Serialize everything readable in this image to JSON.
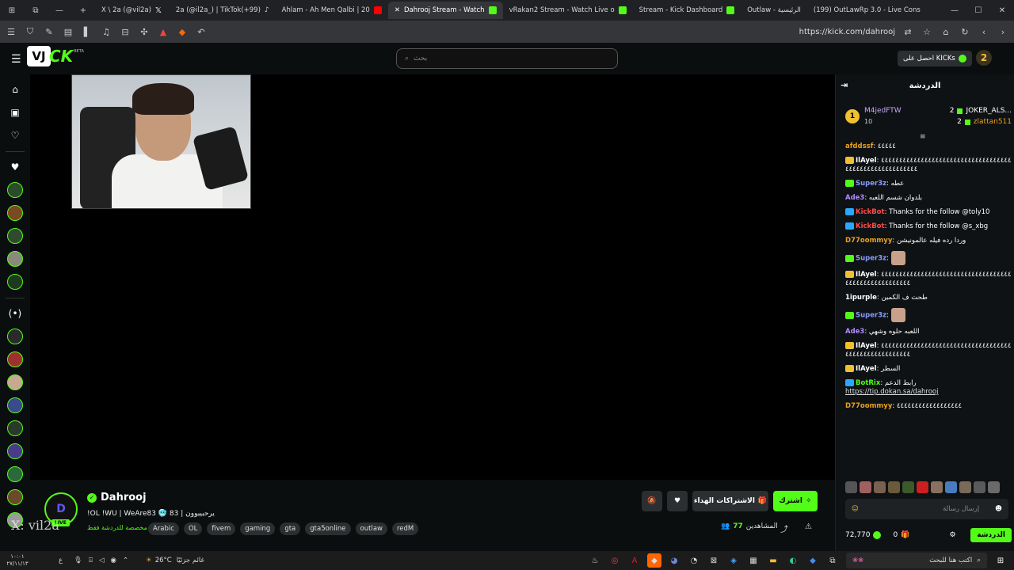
{
  "browser": {
    "tabs": [
      {
        "label": "X \\ 2a (@vil2a)",
        "active": false
      },
      {
        "label": "2a (@il2a_) | TikTok(+99)",
        "active": false
      },
      {
        "label": "Ahlam - Ah Men Qalbi | 20",
        "active": false
      },
      {
        "label": "Dahrooj Stream - Watch",
        "active": true
      },
      {
        "label": "vRakan2 Stream - Watch Live o",
        "active": false
      },
      {
        "label": "Stream - Kick Dashboard",
        "active": false
      },
      {
        "label": "Outlaw - الرئيسية",
        "active": false
      },
      {
        "label": "(199) OutLawRp 3.0 - Live Cons",
        "active": false
      }
    ],
    "url": "https://kick.com/dahrooj"
  },
  "kick": {
    "logo_mark": "VJ",
    "logo_text": "CK",
    "beta": "BETA",
    "search_placeholder": "بحث",
    "get_kicks": "احصل على KICKs"
  },
  "streamer": {
    "name": "Dahrooj",
    "title": "!OL !WU | WeAre83 🥶 83 | يرحبيبوون",
    "category": "مخصصة للدردشة فقط",
    "tags": [
      "Arabic",
      "OL",
      "fivem",
      "gaming",
      "gta",
      "gta5online",
      "outlaw",
      "redM"
    ],
    "live_label": "LIVE",
    "watermark": "X: vil2a",
    "viewers_label": "المشاهدين",
    "viewers_count": "77"
  },
  "actions": {
    "gift_subs": "الاشتراكات الهداء",
    "subscribe": "اشترك"
  },
  "chat": {
    "header": "الدردشة",
    "pinned_user": "M4jedFTW",
    "pinned_count": "10",
    "pinned_rank": "1",
    "gifters": [
      {
        "name": "JOKER_ALS...",
        "count": "2"
      },
      {
        "name": "zlattan511",
        "count": "2"
      }
    ],
    "messages": [
      {
        "user": "afddssf",
        "color": "#e8a020",
        "text": "٤٤٤٤٤",
        "badge": ""
      },
      {
        "user": "IlAyel",
        "color": "#ffffff",
        "text": "٤٤٤٤٤٤٤٤٤٤٤٤٤٤٤٤٤٤٤٤٤٤٤٤٤٤٤٤٤٤٤٤٤٤٤٤٤٤٤٤٤٤٤٤٤٤٤٤٤٤٤٤٤٤٤٤",
        "badge": "#f0c030"
      },
      {
        "user": "Super3z",
        "color": "#8a9cff",
        "text": "عطه",
        "badge": "#53fc18"
      },
      {
        "user": "Ade3",
        "color": "#b08aff",
        "text": "بلدوان شسم اللعبه",
        "badge": ""
      },
      {
        "user": "KickBot",
        "color": "#ff4a4a",
        "text": "Thanks for the follow @toly10",
        "badge": "#2aa8ff"
      },
      {
        "user": "KickBot",
        "color": "#ff4a4a",
        "text": "Thanks for the follow @s_xbg",
        "badge": "#2aa8ff"
      },
      {
        "user": "D77oommyy",
        "color": "#e8a020",
        "text": "وردا رده فيله عالمونيشن",
        "badge": ""
      },
      {
        "user": "Super3z",
        "color": "#8a9cff",
        "text": "",
        "badge": "#53fc18",
        "emote": true
      },
      {
        "user": "IlAyel",
        "color": "#ffffff",
        "text": "٤٤٤٤٤٤٤٤٤٤٤٤٤٤٤٤٤٤٤٤٤٤٤٤٤٤٤٤٤٤٤٤٤٤٤٤٤٤٤٤٤٤٤٤٤٤٤٤٤٤٤٤٤٤",
        "badge": "#f0c030"
      },
      {
        "user": "1ipurple",
        "color": "#ffffff",
        "text": "طحت ف الكمين",
        "badge": ""
      },
      {
        "user": "Super3z",
        "color": "#8a9cff",
        "text": "",
        "badge": "#53fc18",
        "emote": true
      },
      {
        "user": "Ade3",
        "color": "#b08aff",
        "text": "اللعبه حلوه وشهي",
        "badge": ""
      },
      {
        "user": "IlAyel",
        "color": "#ffffff",
        "text": "٤٤٤٤٤٤٤٤٤٤٤٤٤٤٤٤٤٤٤٤٤٤٤٤٤٤٤٤٤٤٤٤٤٤٤٤٤٤٤٤٤٤٤٤٤٤٤٤٤٤٤٤٤٤",
        "badge": "#f0c030"
      },
      {
        "user": "IlAyel",
        "color": "#ffffff",
        "text": "السطر",
        "badge": "#f0c030"
      },
      {
        "user": "BotRix",
        "color": "#53fc18",
        "text": "رابط الدعم",
        "badge": "#2aa8ff",
        "link": "https://tip.dokan.sa/dahrooj"
      },
      {
        "user": "D77oommyy",
        "color": "#e8a020",
        "text": "٤٤٤٤٤٤٤٤٤٤٤٤٤٤٤٤٤٤",
        "badge": ""
      }
    ],
    "input_placeholder": "إرسال رسالة",
    "kicks_balance": "72,770",
    "gift_count": "0",
    "chat_button": "الدردشة"
  },
  "taskbar": {
    "weather_temp": "26°C",
    "weather_text": "غائم جزئيًا",
    "search_placeholder": "اكتب هنا للبحث",
    "time": "١٠:٠١",
    "date": "٢٧/١١/١٣",
    "lang": "ع"
  }
}
